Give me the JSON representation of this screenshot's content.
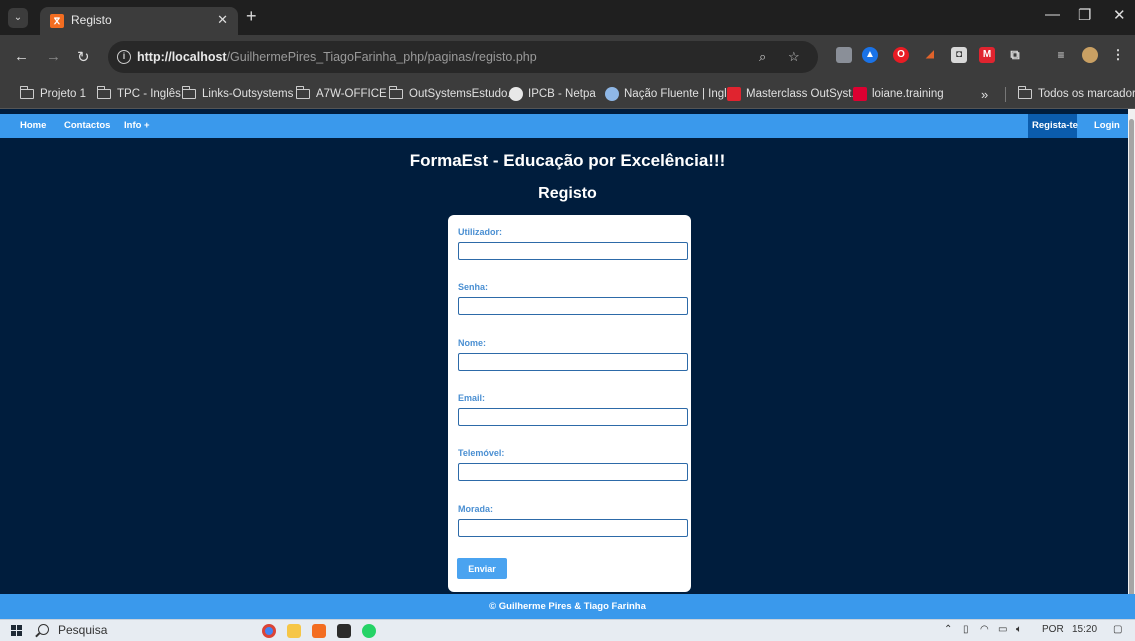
{
  "browser": {
    "tab_title": "Registo",
    "url_host": "http://localhost",
    "url_path": "/GuilhermePires_TiagoFarinha_php/paginas/registo.php",
    "bookmarks": [
      {
        "label": "Projeto 1",
        "icon": "folder-icon"
      },
      {
        "label": "TPC - Inglês",
        "icon": "folder-icon"
      },
      {
        "label": "Links-Outsystems",
        "icon": "folder-icon"
      },
      {
        "label": "A7W-OFFICE",
        "icon": "folder-icon"
      },
      {
        "label": "OutSystemsEstudo...",
        "icon": "folder-icon"
      },
      {
        "label": "IPCB - Netpa",
        "icon": "globe-icon"
      },
      {
        "label": "Nação Fluente | Ingl...",
        "icon": "nacao-fluente-icon"
      },
      {
        "label": "Masterclass OutSyst...",
        "icon": "masterclass-icon"
      },
      {
        "label": "loiane.training",
        "icon": "angular-icon"
      }
    ],
    "overflow_chevron": "»",
    "all_bookmarks": "Todos os marcadores"
  },
  "site": {
    "nav_left": [
      "Home",
      "Contactos",
      "Info +"
    ],
    "nav_right": [
      "Regista-te",
      "Login"
    ],
    "title": "FormaEst - Educação por Excelência!!!",
    "heading": "Registo",
    "fields": [
      {
        "label": "Utilizador:",
        "value": ""
      },
      {
        "label": "Senha:",
        "value": ""
      },
      {
        "label": "Nome:",
        "value": ""
      },
      {
        "label": "Email:",
        "value": ""
      },
      {
        "label": "Telemóvel:",
        "value": ""
      },
      {
        "label": "Morada:",
        "value": ""
      }
    ],
    "submit_label": "Enviar",
    "footer": "© Guilherme Pires & Tiago Farinha"
  },
  "taskbar": {
    "search_label": "Pesquisa",
    "language": "POR",
    "time": "15:20"
  },
  "colors": {
    "page_bg": "#001d3d",
    "nav_bar": "#3a99ec",
    "nav_active": "#0b5cad",
    "label_blue": "#4a8fd2"
  }
}
